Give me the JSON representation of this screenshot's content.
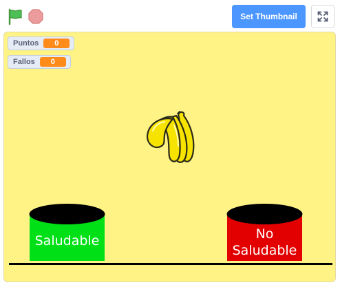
{
  "toolbar": {
    "green_flag_icon": "green-flag-icon",
    "stop_icon": "stop-sign-icon",
    "thumbnail_label": "Set Thumbnail",
    "fullscreen_icon": "fullscreen-icon"
  },
  "monitors": [
    {
      "label": "Puntos",
      "value": "0"
    },
    {
      "label": "Fallos",
      "value": "0"
    }
  ],
  "sprites": {
    "banana_icon": "banana-bunch-icon"
  },
  "bins": {
    "healthy": {
      "label": "Saludable",
      "color": "#00e016"
    },
    "unhealthy": {
      "line1": "No",
      "line2": "Saludable",
      "color": "#e30000"
    }
  },
  "colors": {
    "stage_bg": "#fff385",
    "accent": "#4c97ff",
    "monitor_value": "#ff8c1a"
  }
}
